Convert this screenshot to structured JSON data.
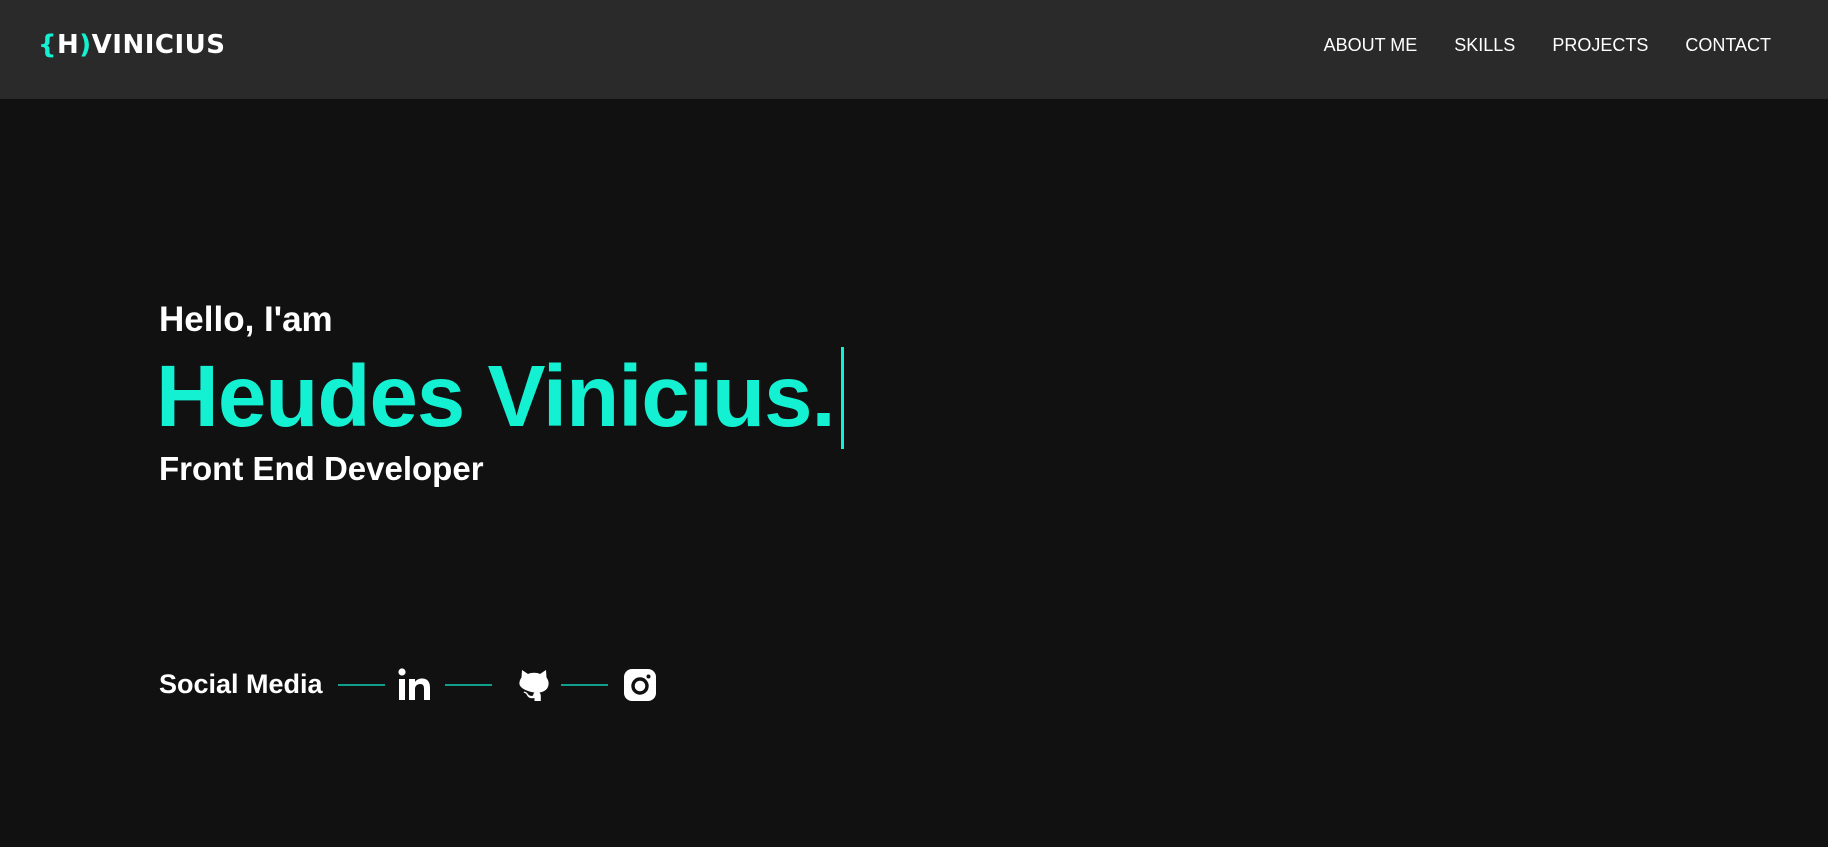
{
  "header": {
    "logo": {
      "open_brace": "{",
      "letter": "H",
      "close_paren": ")",
      "name": "VINICIUS"
    },
    "nav": [
      {
        "label": "ABOUT ME"
      },
      {
        "label": "SKILLS"
      },
      {
        "label": "PROJECTS"
      },
      {
        "label": "CONTACT"
      }
    ]
  },
  "hero": {
    "greeting": "Hello, I'am",
    "name": "Heudes Vinicius.",
    "role": "Front End Developer"
  },
  "social": {
    "label": "Social Media",
    "icons": [
      "linkedin-icon",
      "github-icon",
      "instagram-icon"
    ]
  },
  "colors": {
    "background": "#121112",
    "header": "#2a2a2a",
    "accent": "#14f0d2",
    "divider": "#0f9f8a",
    "text": "#ffffff"
  }
}
